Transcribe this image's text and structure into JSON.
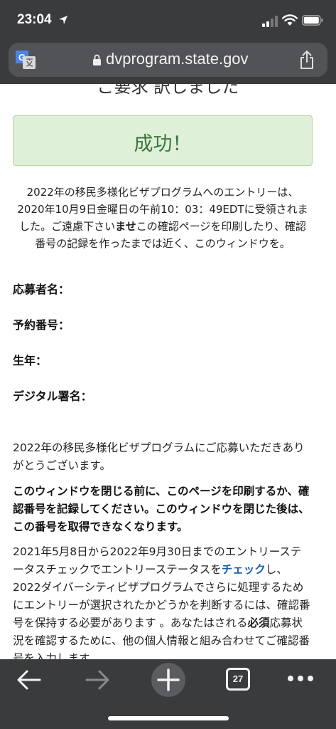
{
  "status_bar": {
    "time": "23:04"
  },
  "address_bar": {
    "url": "dvprogram.state.gov"
  },
  "page": {
    "clipped_heading": "ご要求 訳しました",
    "success_text": "成功！",
    "intro_text": "2022年の移民多様化ビザプログラムへのエントリーは、2020年10月9日金曜日の午前10：03：49EDTに受領されました。ご遠慮下さい",
    "intro_bold": "ませ",
    "intro_tail": "この確認ページを印刷したり、確認番号の記録を作ったまでは近く、このウィンドウを。",
    "fields": {
      "applicant_name": "応募者名：",
      "confirmation_number": "予約番号：",
      "birth_year": "生年：",
      "digital_signature": "デジタル署名："
    },
    "thanks": "2022年の移民多様化ビザプログラムにご応募いただきありがとうございます。",
    "warning": "このウィンドウを閉じる前に、このページを印刷するか、確認番号を記録してください。このウィンドウを閉じた後は、この番号を取得できなくなります。",
    "status_check_pre": "2021年5月8日から2022年9月30日までのエントリーステータスチェックでエントリーステータスを",
    "status_check_link": "チェック",
    "status_check_post": "し、2022ダイバーシティビザプログラムでさらに処理するためにエントリーが選択されたかどうかを判断するには、確認番号を保持する必要があります 。あなたはされる",
    "status_check_bold": "必須",
    "status_check_tail": "応募状況を確認するために、他の個人情報と組み合わせてご確認番号を入力します。"
  },
  "toolbar": {
    "tab_count": "27"
  },
  "colors": {
    "chrome": "#3a3b3d",
    "success_bg": "#dff0d8",
    "success_text": "#3c763d",
    "link": "#1a5fa8"
  }
}
